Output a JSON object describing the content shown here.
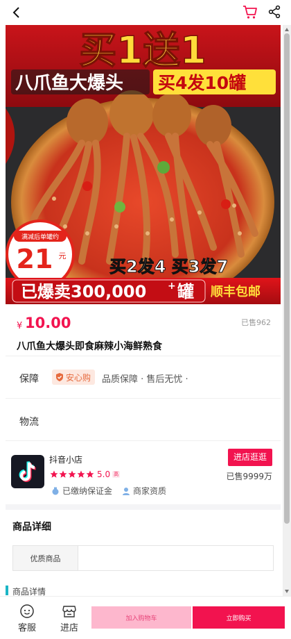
{
  "colors": {
    "accent": "#f2134f",
    "badge_bg": "#fde8e0",
    "badge_text": "#e66a3d",
    "add_cart_bg": "#fdb7cd"
  },
  "topbar": {
    "back_icon": "chevron-left-icon",
    "cart_icon": "cart-icon",
    "share_icon": "share-icon"
  },
  "hero": {
    "headline": "买1送1",
    "product_line": "八爪鱼大爆头",
    "promo_line": "买4发10罐",
    "circle_top": "满减后单罐约",
    "circle_price": "21",
    "circle_unit": "元",
    "bundle_text": "买2发4 买3发7",
    "sold_banner": "已爆卖300,000",
    "sold_plus": "+",
    "sold_unit": "罐",
    "shipping": "顺丰包邮"
  },
  "product": {
    "currency": "¥",
    "price": "10.00",
    "sold": "已售962",
    "title": "八爪鱼大爆头即食麻辣小海鲜熟食"
  },
  "guarantee": {
    "label": "保障",
    "badge": "安心购",
    "text": "品质保障 · 售后无忧 ·"
  },
  "logistics": {
    "label": "物流"
  },
  "shop": {
    "name": "抖音小店",
    "rating": "5.0",
    "rating_tag": "高",
    "stars": 5,
    "visit_button": "进店逛逛",
    "sold_total": "已售9999万",
    "cert_deposit": "已缴纳保证金",
    "cert_qualification": "商家资质"
  },
  "details": {
    "heading": "商品详细",
    "spec_key": "优质商品",
    "spec_value": "",
    "section_label": "商品详情"
  },
  "bottom": {
    "customer_service": "客服",
    "store": "进店",
    "add_to_cart": "加入购物车",
    "buy_now": "立即购买"
  }
}
